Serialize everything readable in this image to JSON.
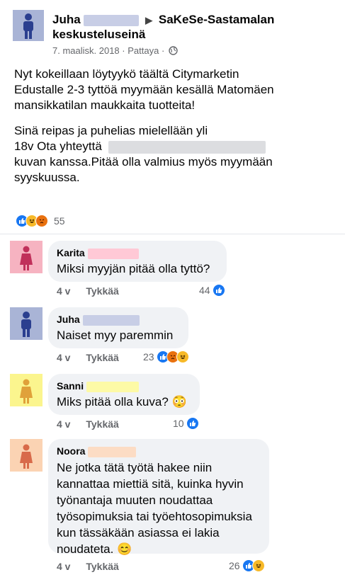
{
  "post": {
    "author_first": "Juha",
    "arrow": "▶",
    "group_name": "SaKeSe-Sastamalan keskusteluseinä",
    "date": "7. maalisk. 2018",
    "privacy": "Pattaya",
    "paragraph1": "Nyt kokeillaan löytyykö täältä Citymarketin Edustalle 2-3 tyttöä myymään kesällä Matomäen mansikkatilan maukkaita tuotteita!",
    "paragraph2_line1": "Sinä reipas ja puhelias mielellään yli",
    "paragraph2_line2": "18v Ota yhteyttä",
    "paragraph2_rest": "kuvan kanssa.Pitää olla valmius myös myymään syyskuussa.",
    "reaction_count": "55"
  },
  "comments": [
    {
      "name": "Karita",
      "text": "Miksi myyjän pitää olla tyttö?",
      "age": "4 v",
      "like_label": "Tykkää",
      "count": "44",
      "avatar_bg": "#f6b3c1",
      "figure_color": "#c0305a",
      "redact_color": "#ffc9d6"
    },
    {
      "name": "Juha",
      "text": "Naiset myy paremmin",
      "age": "4 v",
      "like_label": "Tykkää",
      "count": "23",
      "avatar_bg": "#a9b4d6",
      "figure_color": "#2b3f8f",
      "redact_color": "#c8cee6"
    },
    {
      "name": "Sanni",
      "text": "Miks pitää olla kuva? 😳",
      "age": "4 v",
      "like_label": "Tykkää",
      "count": "10",
      "avatar_bg": "#fbf58e",
      "figure_color": "#e0a13a",
      "redact_color": "#fdfaa6"
    },
    {
      "name": "Noora",
      "text": "Ne jotka tätä työtä hakee niin kannattaa miettiä sitä, kuinka hyvin työnantaja muuten noudattaa työsopimuksia tai työehtosopimuksia kun tässäkään asiassa ei lakia noudateta. 😊",
      "age": "4 v",
      "like_label": "Tykkää",
      "count": "26",
      "avatar_bg": "#fbd3b3",
      "figure_color": "#d86a4a",
      "redact_color": "#fcdcc4"
    }
  ],
  "colors": {
    "like_blue": "#1877f2",
    "meta_gray": "#65676b",
    "bubble_bg": "#f0f2f5"
  },
  "icons": [
    "globe-icon",
    "like-reaction-icon",
    "haha-reaction-icon",
    "angry-reaction-icon",
    "person-avatar-icon"
  ]
}
